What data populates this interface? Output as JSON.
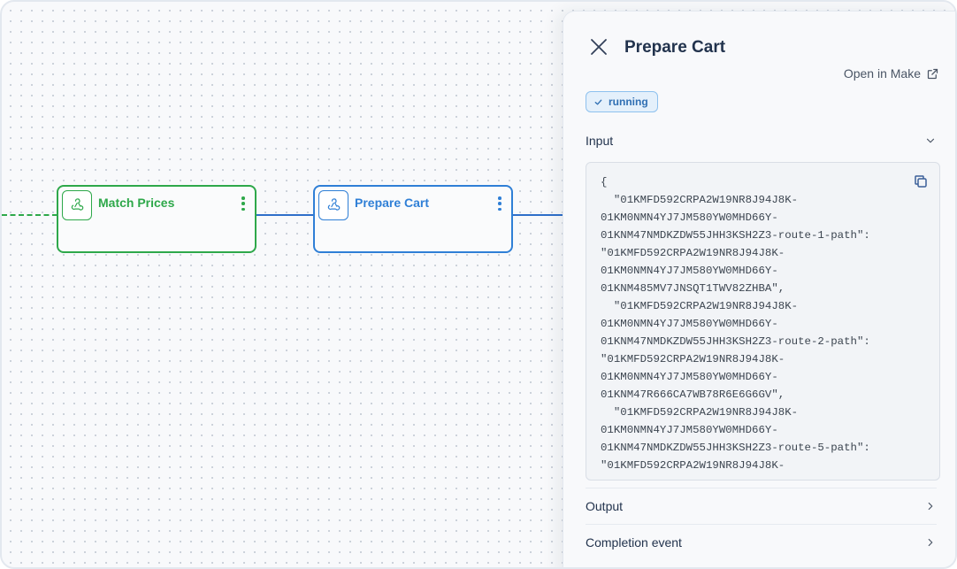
{
  "canvas": {
    "nodes": [
      {
        "title": "Match Prices",
        "status_color": "#2ea84a",
        "icon": "webhook-icon"
      },
      {
        "title": "Prepare Cart",
        "status_color": "#2f7fd6",
        "icon": "webhook-icon"
      }
    ]
  },
  "panel": {
    "title": "Prepare Cart",
    "open_link": "Open in Make",
    "status": "running",
    "sections": {
      "input": "Input",
      "output": "Output",
      "completion": "Completion event"
    },
    "input_code": "{\n  \"01KMFD592CRPA2W19NR8J94J8K-\n01KM0NMN4YJ7JM580YW0MHD66Y-\n01KNM47NMDKZDW55JHH3KSH2Z3-route-1-path\":\n\"01KMFD592CRPA2W19NR8J94J8K-\n01KM0NMN4YJ7JM580YW0MHD66Y-\n01KNM485MV7JNSQT1TWV82ZHBA\",\n  \"01KMFD592CRPA2W19NR8J94J8K-\n01KM0NMN4YJ7JM580YW0MHD66Y-\n01KNM47NMDKZDW55JHH3KSH2Z3-route-2-path\":\n\"01KMFD592CRPA2W19NR8J94J8K-\n01KM0NMN4YJ7JM580YW0MHD66Y-\n01KNM47R666CA7WB78R6E6G6GV\",\n  \"01KMFD592CRPA2W19NR8J94J8K-\n01KM0NMN4YJ7JM580YW0MHD66Y-\n01KNM47NMDKZDW55JHH3KSH2Z3-route-5-path\":\n\"01KMFD592CRPA2W19NR8J94J8K-"
  },
  "colors": {
    "accent": "#2f7fd6",
    "success": "#2ea84a"
  }
}
